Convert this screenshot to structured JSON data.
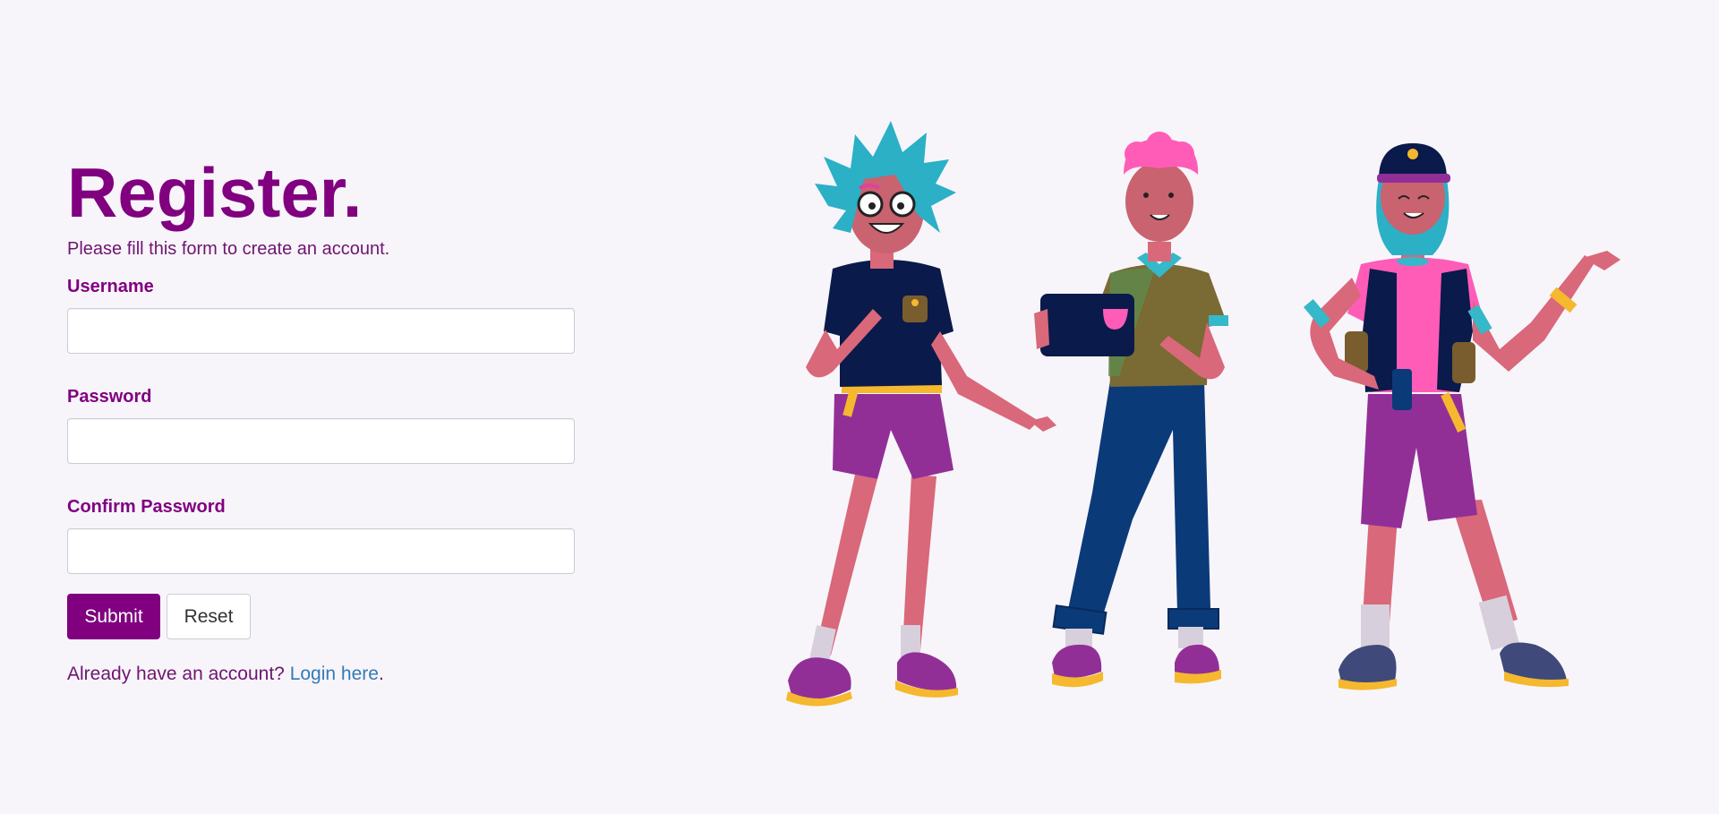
{
  "form": {
    "title": "Register.",
    "subtitle": "Please fill this form to create an account.",
    "fields": [
      {
        "label": "Username",
        "value": "",
        "type": "text"
      },
      {
        "label": "Password",
        "value": "",
        "type": "password"
      },
      {
        "label": "Confirm Password",
        "value": "",
        "type": "password"
      }
    ],
    "submit_label": "Submit",
    "reset_label": "Reset",
    "login_prompt": "Already have an account?",
    "login_link": "Login here",
    "login_suffix": "."
  },
  "colors": {
    "background": "#f7f5fa",
    "accent": "#800080",
    "text": "#6e1570",
    "link": "#337ab7"
  },
  "illustration": {
    "subject": "three-people-illustration"
  }
}
